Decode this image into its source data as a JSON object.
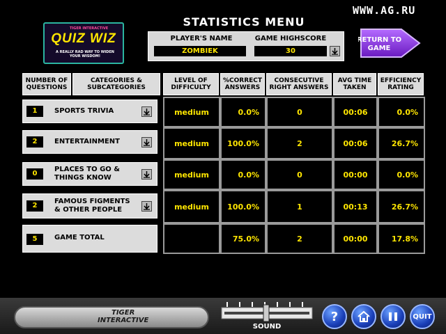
{
  "watermark": "WWW.AG.RU",
  "title": "STATISTICS MENU",
  "logo": {
    "brand": "TIGER INTERACTIVE",
    "name": "QUIZ WIZ",
    "tagline": "A REALLY RAD WAY TO WIDEN YOUR WISDOM!"
  },
  "player": {
    "name_label": "PLAYER'S NAME",
    "name_value": "ZOMBIEK",
    "highscore_label": "GAME HIGHSCORE",
    "highscore_value": "30"
  },
  "return_button": {
    "line1": "RETURN TO",
    "line2": "GAME"
  },
  "columns": {
    "questions": [
      "NUMBER OF",
      "QUESTIONS"
    ],
    "categories": [
      "CATEGORIES &",
      "SUBCATEGORIES"
    ],
    "difficulty": [
      "LEVEL OF",
      "DIFFICULTY"
    ],
    "correct": [
      "%CORRECT",
      "ANSWERS"
    ],
    "consecutive": [
      "CONSECUTIVE",
      "RIGHT ANSWERS"
    ],
    "avgtime": [
      "AVG TIME",
      "TAKEN"
    ],
    "efficiency": [
      "EFFICIENCY",
      "RATING"
    ]
  },
  "rows": [
    {
      "num": "1",
      "cat1": "SPORTS TRIVIA",
      "cat2": "",
      "difficulty": "medium",
      "correct": "0.0%",
      "consecutive": "0",
      "avgtime": "00:06",
      "efficiency": "0.0%"
    },
    {
      "num": "2",
      "cat1": "ENTERTAINMENT",
      "cat2": "",
      "difficulty": "medium",
      "correct": "100.0%",
      "consecutive": "2",
      "avgtime": "00:06",
      "efficiency": "26.7%"
    },
    {
      "num": "0",
      "cat1": "PLACES TO GO &",
      "cat2": "THINGS KNOW",
      "difficulty": "medium",
      "correct": "0.0%",
      "consecutive": "0",
      "avgtime": "00:00",
      "efficiency": "0.0%"
    },
    {
      "num": "2",
      "cat1": "FAMOUS FIGMENTS",
      "cat2": "& OTHER PEOPLE",
      "difficulty": "medium",
      "correct": "100.0%",
      "consecutive": "1",
      "avgtime": "00:13",
      "efficiency": "26.7%"
    }
  ],
  "total": {
    "num": "5",
    "label": "GAME TOTAL",
    "difficulty": "",
    "correct": "75.0%",
    "consecutive": "2",
    "avgtime": "00:00",
    "efficiency": "17.8%"
  },
  "bottom": {
    "tiger_line1": "TIGER",
    "tiger_line2": "INTERACTIVE",
    "sound_label": "SOUND",
    "help_label": "?",
    "quit_label": "QUIT",
    "home_icon": "house-icon",
    "pause_icon": "pause-icon"
  },
  "colors": {
    "accent": "#ffe600",
    "panel": "#dcdcdc",
    "return": "#8a2be2",
    "buttons": "#1a3fb8"
  }
}
